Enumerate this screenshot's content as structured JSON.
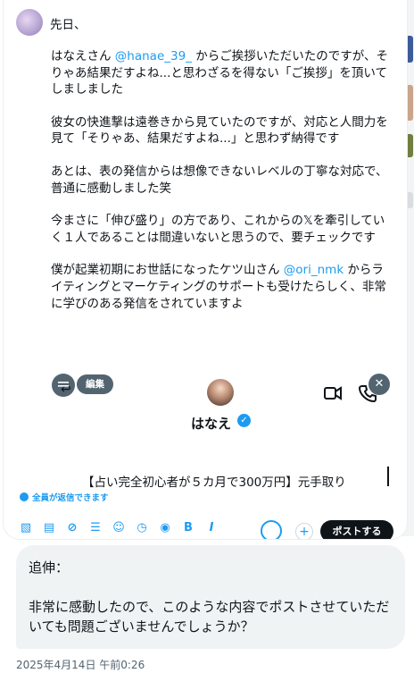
{
  "colors": {
    "accent": "#1d9bf0",
    "text": "#0f1419",
    "muted": "#536471",
    "bubble": "#eff3f4"
  },
  "post": {
    "greeting": "先日、",
    "p1_a": "はなえさん ",
    "p1_mention": "@hanae_39_",
    "p1_b": " からご挨拶いただいたのですが、そりゃあ結果だすよね...と思わざるを得ない「ご挨拶」を頂いてしましました",
    "p2": "彼女の快進撃は遠巻きから見ていたのですが、対応と人間力を見て「そりゃあ、結果だすよね...」と思わず納得です",
    "p3": "あとは、表の発信からは想像できないレベルの丁寧な対応で、普通に感動しました笑",
    "p4": "今まさに「伸び盛り」の方であり、これからの𝕏を牽引していく１人であることは間違いないと思うので、要チェックです",
    "p5_a": "僕が起業初期にお世話になったケツ山さん ",
    "p5_mention": "@ori_nmk",
    "p5_b": " からライティングとマーケティングのサポートも受けたらしく、非常に学びのある発信をされていますよ"
  },
  "composer": {
    "edit_label": "編集",
    "profile_name": "はなえ",
    "draft_text": "【占い完全初心者が５カ月で300万円】元手取り",
    "reply_setting": "全員が返信できます",
    "post_button": "ポストする",
    "toolbar_icons": [
      "image-icon",
      "gif-icon",
      "grok-icon",
      "poll-icon",
      "emoji-icon",
      "schedule-icon",
      "location-icon",
      "bold-icon",
      "italic-icon"
    ]
  },
  "message": {
    "line1": "追伸：",
    "line2": "非常に感動したので、このような内容でポストさせていただいても問題ございませんでしょうか？",
    "timestamp": "2025年4月14日 午前0:26"
  }
}
